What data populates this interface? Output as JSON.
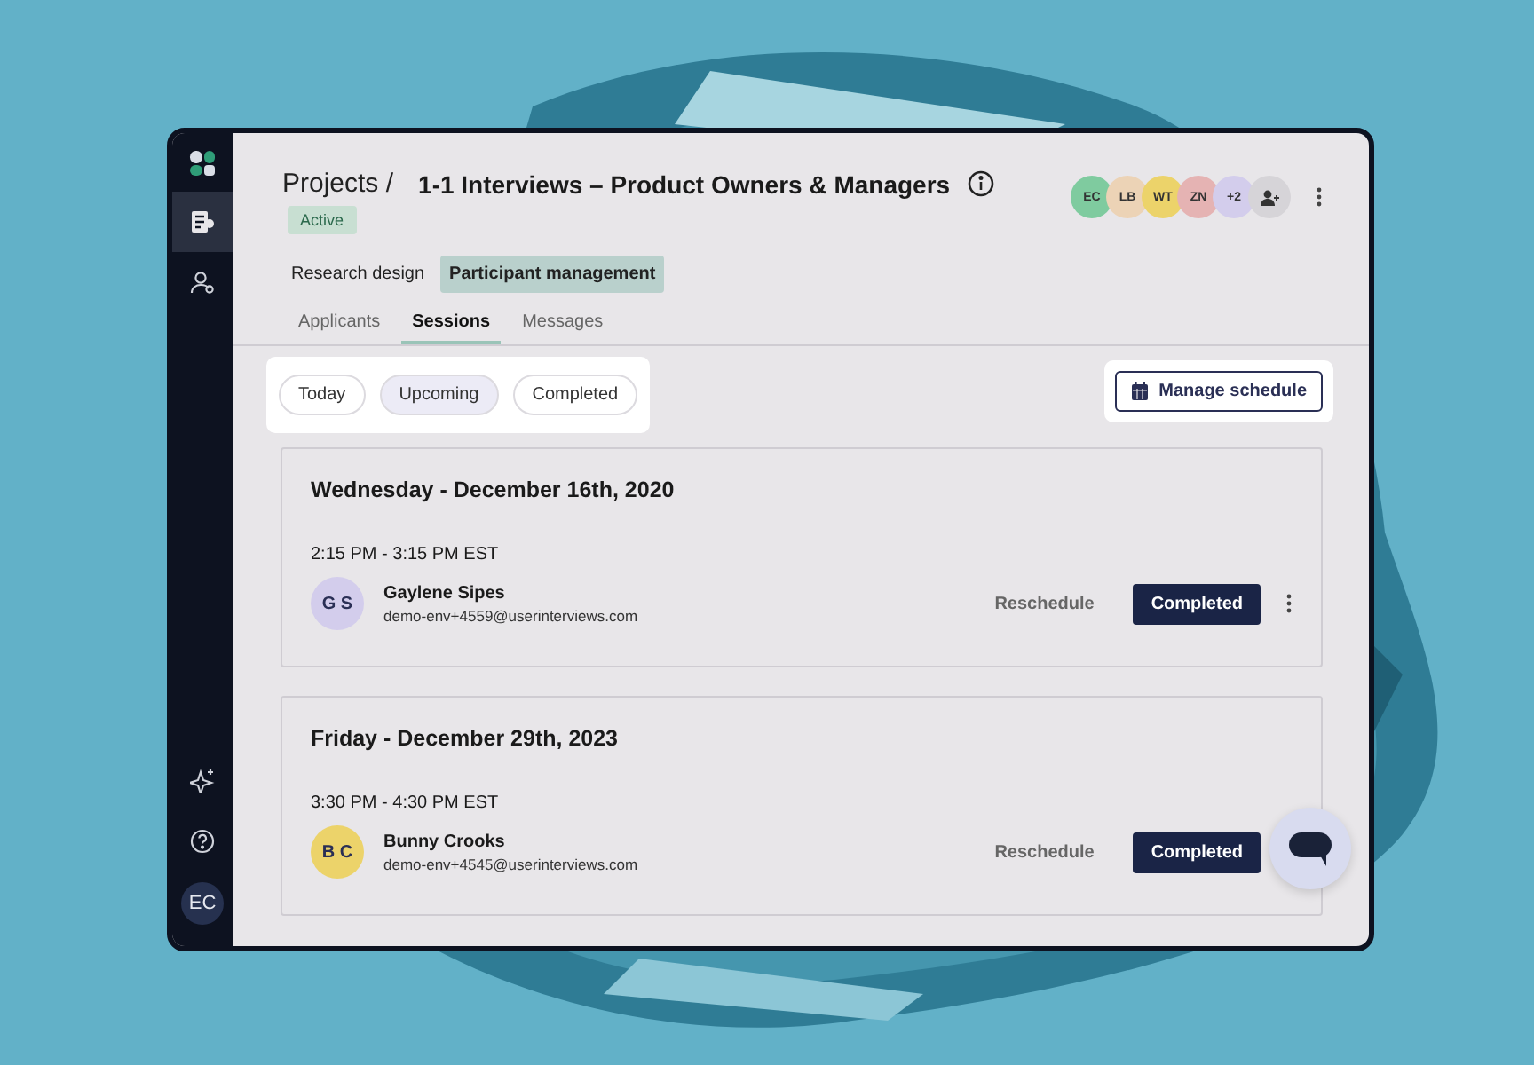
{
  "sidebar": {
    "items": [
      {
        "kind": "projects",
        "selected": true
      },
      {
        "kind": "people",
        "selected": false
      }
    ],
    "bottom_items": [
      {
        "kind": "sparkle"
      },
      {
        "kind": "help"
      }
    ],
    "user_avatar": "EC"
  },
  "header": {
    "breadcrumb": "Projects /",
    "title": "1-1 Interviews – Product Owners & Managers",
    "status": "Active",
    "team": [
      {
        "initials": "EC",
        "color": "#7fcb9f"
      },
      {
        "initials": "LB",
        "color": "#ecd3b6"
      },
      {
        "initials": "WT",
        "color": "#ecd36a"
      },
      {
        "initials": "ZN",
        "color": "#e5b3b3"
      },
      {
        "initials": "+2",
        "color": "#d3cdec"
      }
    ]
  },
  "sections": [
    {
      "label": "Research design",
      "selected": false
    },
    {
      "label": "Participant management",
      "selected": true
    }
  ],
  "tabs": [
    {
      "label": "Applicants",
      "selected": false
    },
    {
      "label": "Sessions",
      "selected": true
    },
    {
      "label": "Messages",
      "selected": false
    }
  ],
  "filters": [
    {
      "label": "Today",
      "selected": false
    },
    {
      "label": "Upcoming",
      "selected": true
    },
    {
      "label": "Completed",
      "selected": false
    }
  ],
  "manage_button": "Manage schedule",
  "sessions": [
    {
      "date": "Wednesday - December 16th, 2020",
      "time": "2:15 PM - 3:15 PM EST",
      "initials": "G S",
      "color": "#d3cdec",
      "name": "Gaylene Sipes",
      "email": "demo-env+4559@userinterviews.com",
      "action": "Reschedule",
      "status": "Completed"
    },
    {
      "date": "Friday - December 29th, 2023",
      "time": "3:30 PM - 4:30 PM EST",
      "initials": "B C",
      "color": "#ecd36a",
      "name": "Bunny Crooks",
      "email": "demo-env+4545@userinterviews.com",
      "action": "Reschedule",
      "status": "Completed"
    }
  ]
}
